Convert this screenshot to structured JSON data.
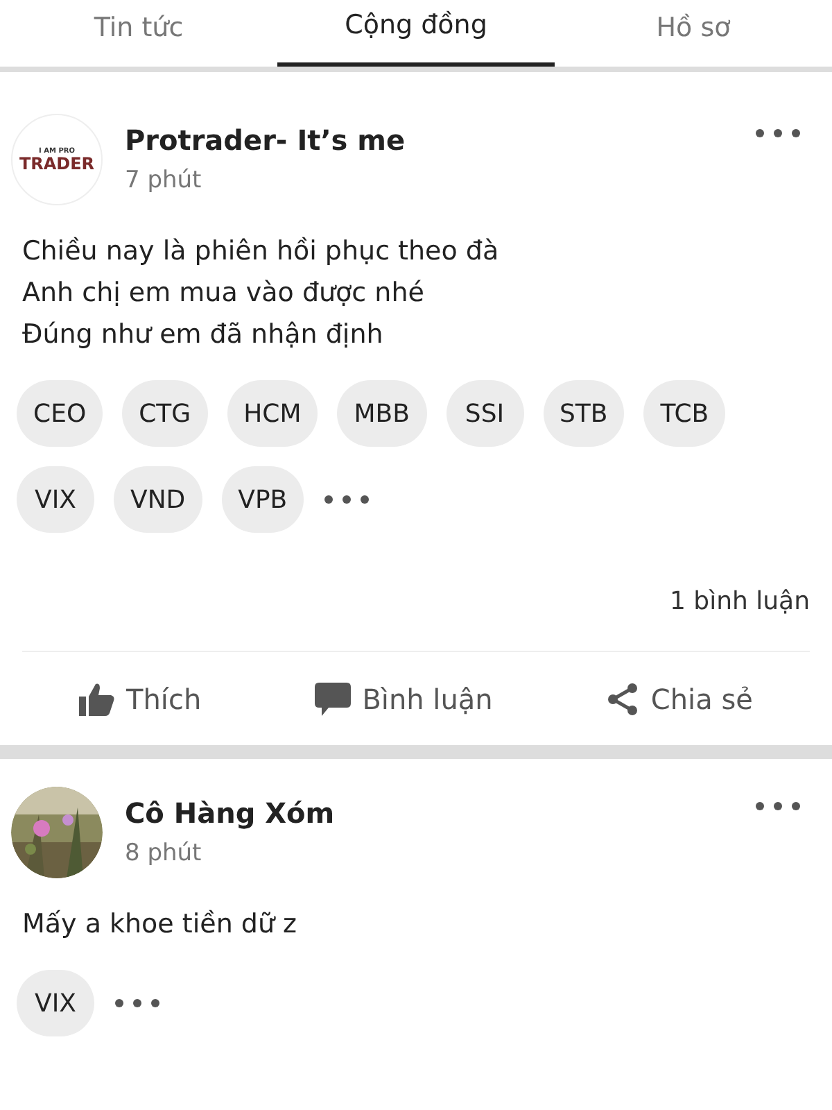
{
  "tabs": [
    {
      "label": "Tin tức",
      "selected": false
    },
    {
      "label": "Cộng đồng",
      "selected": true
    },
    {
      "label": "Hồ sơ",
      "selected": false
    }
  ],
  "posts": [
    {
      "author": "Protrader- It’s me",
      "avatar": {
        "kind": "logo",
        "lines": [
          "I AM PRO",
          "TRADER"
        ]
      },
      "time": "7 phút",
      "lines": [
        "Chiều nay là phiên hồi phục theo đà",
        "Anh chị em mua vào được nhé",
        "Đúng như em đã nhận định"
      ],
      "tags": [
        "CEO",
        "CTG",
        "HCM",
        "MBB",
        "SSI",
        "STB",
        "TCB",
        "VIX",
        "VND",
        "VPB"
      ],
      "more_tags": true,
      "comment_count": "1 bình luận",
      "actions": [
        {
          "kind": "like",
          "label": "Thích"
        },
        {
          "kind": "comment",
          "label": "Bình luận"
        },
        {
          "kind": "share",
          "label": "Chia sẻ"
        }
      ]
    },
    {
      "author": "Cô Hàng Xóm",
      "avatar": {
        "kind": "picture"
      },
      "time": "8 phút",
      "lines": [
        "Mấy a khoe tiền dữ z"
      ],
      "tags": [
        "VIX"
      ],
      "more_tags": true
    }
  ]
}
